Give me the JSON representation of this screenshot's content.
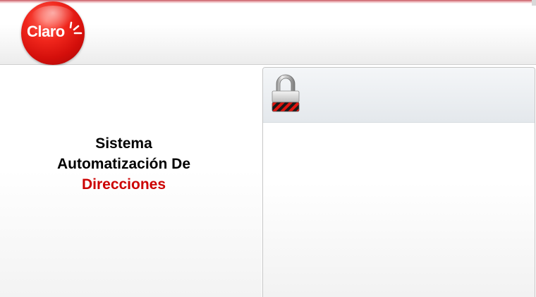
{
  "header": {
    "logo_text": "Claro",
    "logo_icon": "claro-logo"
  },
  "main": {
    "title_line1": "Sistema",
    "title_line2": "Automatización De",
    "title_accent": "Direcciones"
  },
  "login_panel": {
    "icon": "lock-icon"
  },
  "colors": {
    "brand_red": "#cc0000",
    "logo_red": "#e0140e"
  }
}
